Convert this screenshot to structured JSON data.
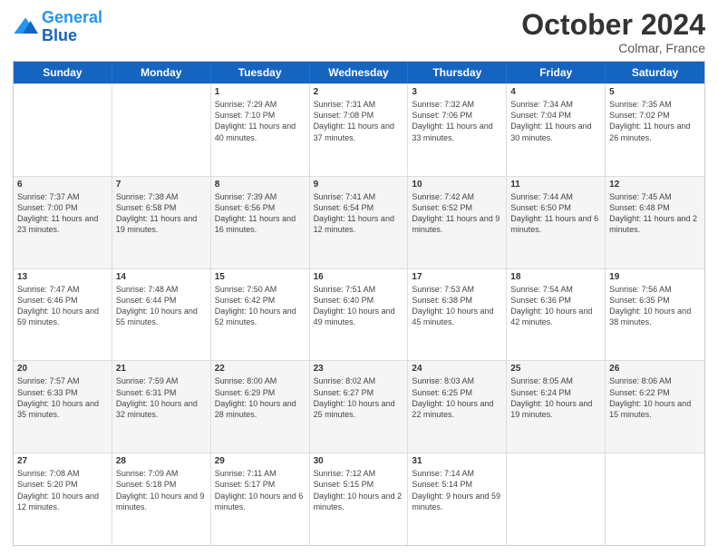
{
  "header": {
    "logo_line1": "General",
    "logo_line2": "Blue",
    "month": "October 2024",
    "location": "Colmar, France"
  },
  "days_of_week": [
    "Sunday",
    "Monday",
    "Tuesday",
    "Wednesday",
    "Thursday",
    "Friday",
    "Saturday"
  ],
  "weeks": [
    {
      "alt": false,
      "cells": [
        {
          "day": "",
          "info": ""
        },
        {
          "day": "",
          "info": ""
        },
        {
          "day": "1",
          "info": "Sunrise: 7:29 AM\nSunset: 7:10 PM\nDaylight: 11 hours and 40 minutes."
        },
        {
          "day": "2",
          "info": "Sunrise: 7:31 AM\nSunset: 7:08 PM\nDaylight: 11 hours and 37 minutes."
        },
        {
          "day": "3",
          "info": "Sunrise: 7:32 AM\nSunset: 7:06 PM\nDaylight: 11 hours and 33 minutes."
        },
        {
          "day": "4",
          "info": "Sunrise: 7:34 AM\nSunset: 7:04 PM\nDaylight: 11 hours and 30 minutes."
        },
        {
          "day": "5",
          "info": "Sunrise: 7:35 AM\nSunset: 7:02 PM\nDaylight: 11 hours and 26 minutes."
        }
      ]
    },
    {
      "alt": true,
      "cells": [
        {
          "day": "6",
          "info": "Sunrise: 7:37 AM\nSunset: 7:00 PM\nDaylight: 11 hours and 23 minutes."
        },
        {
          "day": "7",
          "info": "Sunrise: 7:38 AM\nSunset: 6:58 PM\nDaylight: 11 hours and 19 minutes."
        },
        {
          "day": "8",
          "info": "Sunrise: 7:39 AM\nSunset: 6:56 PM\nDaylight: 11 hours and 16 minutes."
        },
        {
          "day": "9",
          "info": "Sunrise: 7:41 AM\nSunset: 6:54 PM\nDaylight: 11 hours and 12 minutes."
        },
        {
          "day": "10",
          "info": "Sunrise: 7:42 AM\nSunset: 6:52 PM\nDaylight: 11 hours and 9 minutes."
        },
        {
          "day": "11",
          "info": "Sunrise: 7:44 AM\nSunset: 6:50 PM\nDaylight: 11 hours and 6 minutes."
        },
        {
          "day": "12",
          "info": "Sunrise: 7:45 AM\nSunset: 6:48 PM\nDaylight: 11 hours and 2 minutes."
        }
      ]
    },
    {
      "alt": false,
      "cells": [
        {
          "day": "13",
          "info": "Sunrise: 7:47 AM\nSunset: 6:46 PM\nDaylight: 10 hours and 59 minutes."
        },
        {
          "day": "14",
          "info": "Sunrise: 7:48 AM\nSunset: 6:44 PM\nDaylight: 10 hours and 55 minutes."
        },
        {
          "day": "15",
          "info": "Sunrise: 7:50 AM\nSunset: 6:42 PM\nDaylight: 10 hours and 52 minutes."
        },
        {
          "day": "16",
          "info": "Sunrise: 7:51 AM\nSunset: 6:40 PM\nDaylight: 10 hours and 49 minutes."
        },
        {
          "day": "17",
          "info": "Sunrise: 7:53 AM\nSunset: 6:38 PM\nDaylight: 10 hours and 45 minutes."
        },
        {
          "day": "18",
          "info": "Sunrise: 7:54 AM\nSunset: 6:36 PM\nDaylight: 10 hours and 42 minutes."
        },
        {
          "day": "19",
          "info": "Sunrise: 7:56 AM\nSunset: 6:35 PM\nDaylight: 10 hours and 38 minutes."
        }
      ]
    },
    {
      "alt": true,
      "cells": [
        {
          "day": "20",
          "info": "Sunrise: 7:57 AM\nSunset: 6:33 PM\nDaylight: 10 hours and 35 minutes."
        },
        {
          "day": "21",
          "info": "Sunrise: 7:59 AM\nSunset: 6:31 PM\nDaylight: 10 hours and 32 minutes."
        },
        {
          "day": "22",
          "info": "Sunrise: 8:00 AM\nSunset: 6:29 PM\nDaylight: 10 hours and 28 minutes."
        },
        {
          "day": "23",
          "info": "Sunrise: 8:02 AM\nSunset: 6:27 PM\nDaylight: 10 hours and 25 minutes."
        },
        {
          "day": "24",
          "info": "Sunrise: 8:03 AM\nSunset: 6:25 PM\nDaylight: 10 hours and 22 minutes."
        },
        {
          "day": "25",
          "info": "Sunrise: 8:05 AM\nSunset: 6:24 PM\nDaylight: 10 hours and 19 minutes."
        },
        {
          "day": "26",
          "info": "Sunrise: 8:06 AM\nSunset: 6:22 PM\nDaylight: 10 hours and 15 minutes."
        }
      ]
    },
    {
      "alt": false,
      "cells": [
        {
          "day": "27",
          "info": "Sunrise: 7:08 AM\nSunset: 5:20 PM\nDaylight: 10 hours and 12 minutes."
        },
        {
          "day": "28",
          "info": "Sunrise: 7:09 AM\nSunset: 5:18 PM\nDaylight: 10 hours and 9 minutes."
        },
        {
          "day": "29",
          "info": "Sunrise: 7:11 AM\nSunset: 5:17 PM\nDaylight: 10 hours and 6 minutes."
        },
        {
          "day": "30",
          "info": "Sunrise: 7:12 AM\nSunset: 5:15 PM\nDaylight: 10 hours and 2 minutes."
        },
        {
          "day": "31",
          "info": "Sunrise: 7:14 AM\nSunset: 5:14 PM\nDaylight: 9 hours and 59 minutes."
        },
        {
          "day": "",
          "info": ""
        },
        {
          "day": "",
          "info": ""
        }
      ]
    }
  ]
}
